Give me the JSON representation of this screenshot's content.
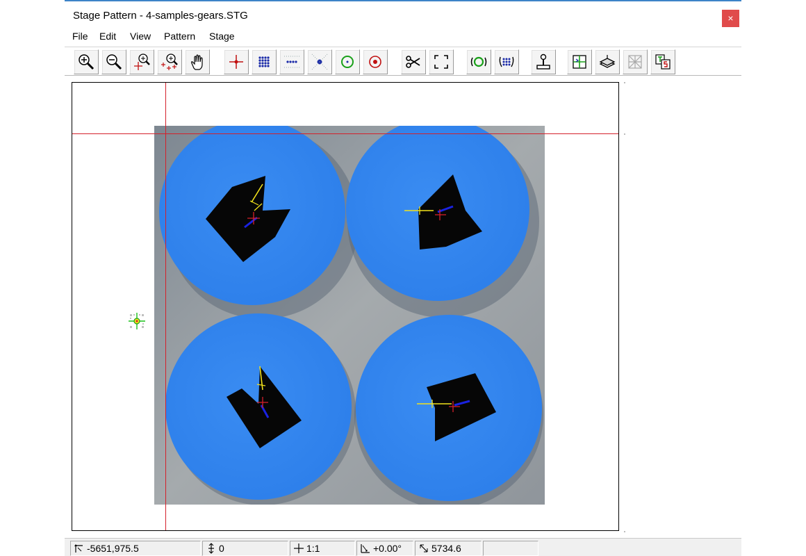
{
  "window": {
    "title": "Stage Pattern - 4-samples-gears.STG",
    "close_glyph": "×"
  },
  "menu": [
    {
      "id": "file",
      "label": "File"
    },
    {
      "id": "edit",
      "label": "Edit"
    },
    {
      "id": "view",
      "label": "View"
    },
    {
      "id": "pattern",
      "label": "Pattern"
    },
    {
      "id": "stage",
      "label": "Stage"
    }
  ],
  "toolbar": [
    {
      "name": "zoom-in",
      "icon": "zoom-in-icon"
    },
    {
      "name": "zoom-out",
      "icon": "zoom-out-icon"
    },
    {
      "name": "zoom-point",
      "icon": "zoom-point-icon"
    },
    {
      "name": "zoom-all-points",
      "icon": "zoom-all-points-icon"
    },
    {
      "name": "pan",
      "icon": "hand-icon"
    },
    {
      "name": "single-point",
      "icon": "crosshair-point-icon"
    },
    {
      "name": "grid-points",
      "icon": "grid-points-icon"
    },
    {
      "name": "line-points",
      "icon": "line-points-icon"
    },
    {
      "name": "center-point",
      "icon": "center-point-icon"
    },
    {
      "name": "circle-points",
      "icon": "circle-points-icon"
    },
    {
      "name": "target-point",
      "icon": "target-icon"
    },
    {
      "name": "cut",
      "icon": "scissors-icon"
    },
    {
      "name": "fit-to-window",
      "icon": "fit-window-icon"
    },
    {
      "name": "rotate-pattern",
      "icon": "rotate-circles-icon"
    },
    {
      "name": "rotate-grid",
      "icon": "rotate-grid-icon"
    },
    {
      "name": "joystick",
      "icon": "joystick-icon"
    },
    {
      "name": "stage-move",
      "icon": "stage-move-icon"
    },
    {
      "name": "scanner",
      "icon": "scanner-icon"
    },
    {
      "name": "disabled-grid",
      "icon": "disabled-grid-icon"
    },
    {
      "name": "text-settings",
      "icon": "text-settings-icon"
    }
  ],
  "status": {
    "coords": "-5651,975.5",
    "z": "0",
    "scale": "1:1",
    "angle": "+0.00°",
    "distance": "5734.6",
    "extra": ""
  },
  "colors": {
    "guide": "#d4202a",
    "sample": "#2f82ee",
    "background_scan": "#8a9097",
    "measure_yellow": "#f2e21b",
    "measure_blue": "#1a22e0"
  }
}
